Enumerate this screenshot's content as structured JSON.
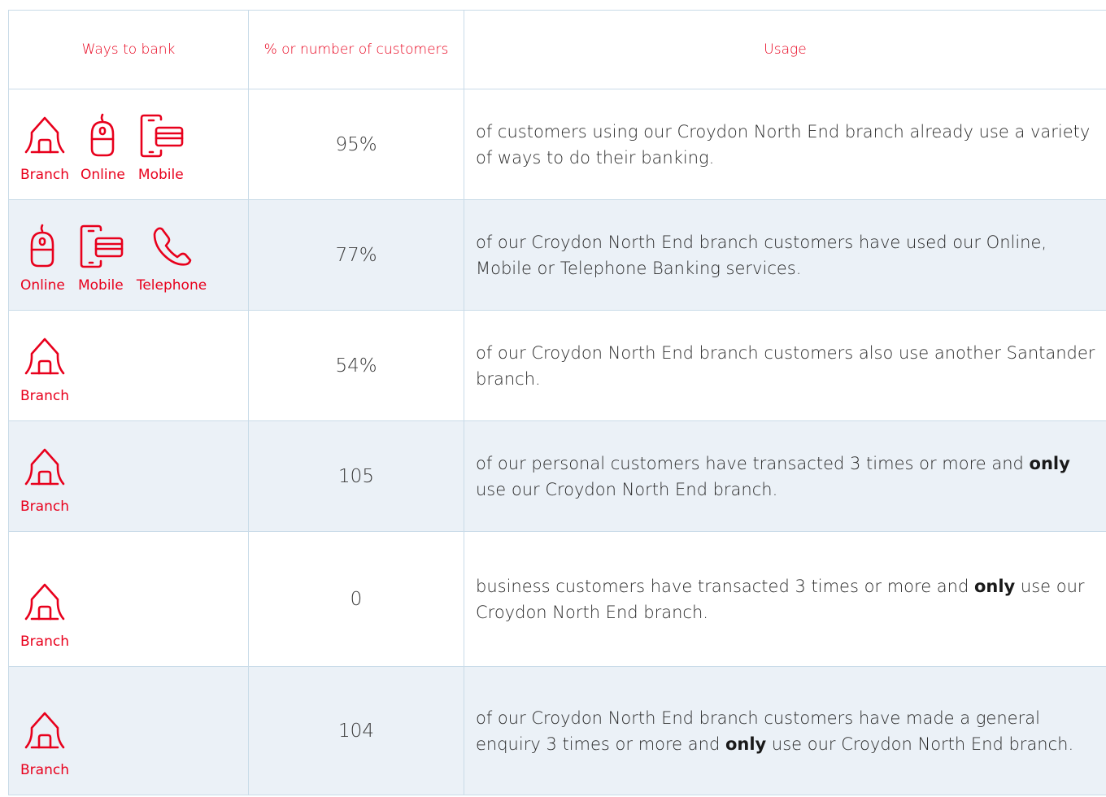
{
  "header": {
    "col1": "Ways to bank",
    "col2": "% or number of customers",
    "col3": "Usage"
  },
  "icons": {
    "Branch": "house-icon",
    "Online": "mouse-icon",
    "Mobile": "mobile-card-icon",
    "Telephone": "phone-icon"
  },
  "accent_color": "#e8001c",
  "rows": [
    {
      "ways": [
        "Branch",
        "Online",
        "Mobile"
      ],
      "value": "95%",
      "usage_pre": "of customers using our Croydon North End branch already use a variety of ways to do their banking.",
      "usage_bold": "",
      "usage_post": ""
    },
    {
      "ways": [
        "Online",
        "Mobile",
        "Telephone"
      ],
      "value": "77%",
      "usage_pre": "of our Croydon North End branch customers have used our Online, Mobile or Telephone Banking services.",
      "usage_bold": "",
      "usage_post": ""
    },
    {
      "ways": [
        "Branch"
      ],
      "value": "54%",
      "usage_pre": "of our Croydon North End branch customers also use another Santander branch.",
      "usage_bold": "",
      "usage_post": ""
    },
    {
      "ways": [
        "Branch"
      ],
      "value": "105",
      "usage_pre": "of our personal customers have transacted 3 times or more and ",
      "usage_bold": "only",
      "usage_post": " use our Croydon North End branch."
    },
    {
      "ways": [
        "Branch"
      ],
      "value": "0",
      "usage_pre": "business customers have transacted 3 times or more and ",
      "usage_bold": "only",
      "usage_post": " use our Croydon North End branch."
    },
    {
      "ways": [
        "Branch"
      ],
      "value": "104",
      "usage_pre": "of our Croydon North End branch customers have made a general enquiry 3 times or more and ",
      "usage_bold": "only",
      "usage_post": " use our Croydon North End branch."
    }
  ]
}
